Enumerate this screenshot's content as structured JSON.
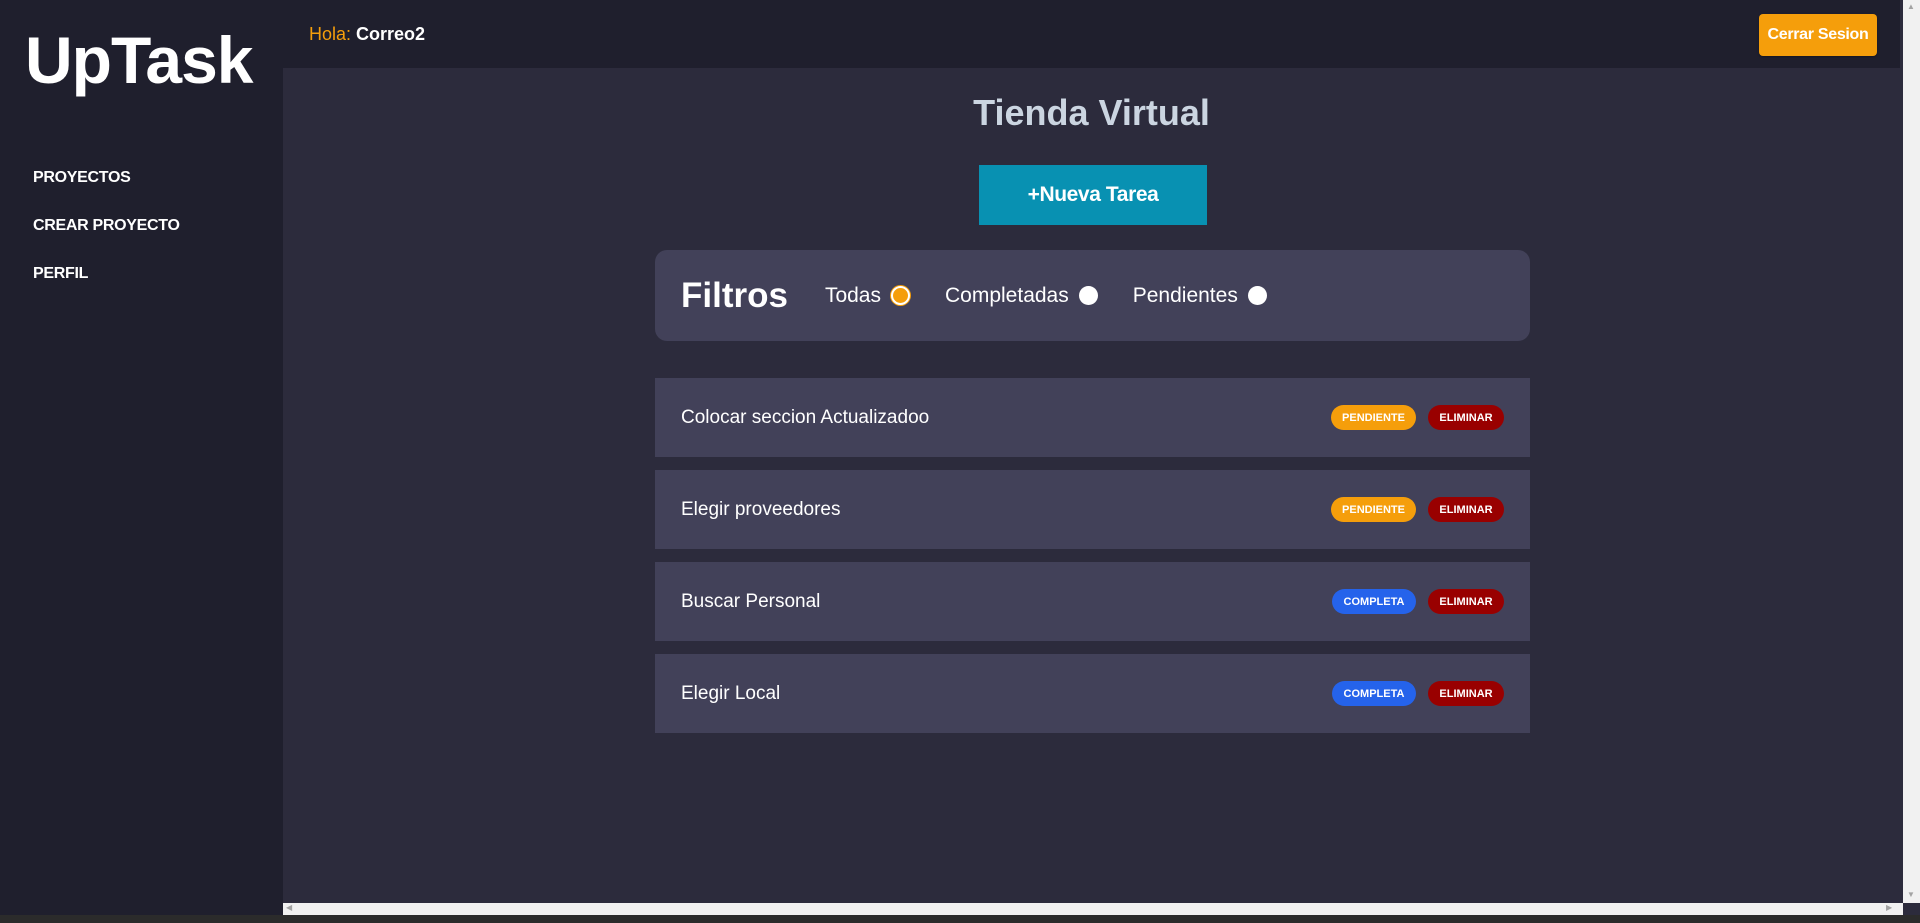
{
  "sidebar": {
    "logo": "UpTask",
    "items": [
      {
        "label": "PROYECTOS"
      },
      {
        "label": "CREAR PROYECTO"
      },
      {
        "label": "PERFIL"
      }
    ]
  },
  "header": {
    "greeting_prefix": "Hola:",
    "user_name": "Correo2",
    "logout_label": "Cerrar Sesion"
  },
  "main": {
    "project_title": "Tienda Virtual",
    "new_task_label": "+Nueva Tarea",
    "filters": {
      "title": "Filtros",
      "options": [
        {
          "label": "Todas",
          "checked": true
        },
        {
          "label": "Completadas",
          "checked": false
        },
        {
          "label": "Pendientes",
          "checked": false
        }
      ]
    },
    "tasks": [
      {
        "name": "Colocar seccion Actualizadoo",
        "status": "PENDIENTE",
        "delete_label": "ELIMINAR"
      },
      {
        "name": "Elegir proveedores",
        "status": "PENDIENTE",
        "delete_label": "ELIMINAR"
      },
      {
        "name": "Buscar Personal",
        "status": "COMPLETA",
        "delete_label": "ELIMINAR"
      },
      {
        "name": "Elegir Local",
        "status": "COMPLETA",
        "delete_label": "ELIMINAR"
      }
    ]
  },
  "colors": {
    "accent": "#f59e0b",
    "primary_button": "#0891b2",
    "complete": "#2563eb",
    "delete": "#990000",
    "background": "#2c2b3c",
    "sidebar": "#1f1f2d",
    "card": "#424159"
  }
}
